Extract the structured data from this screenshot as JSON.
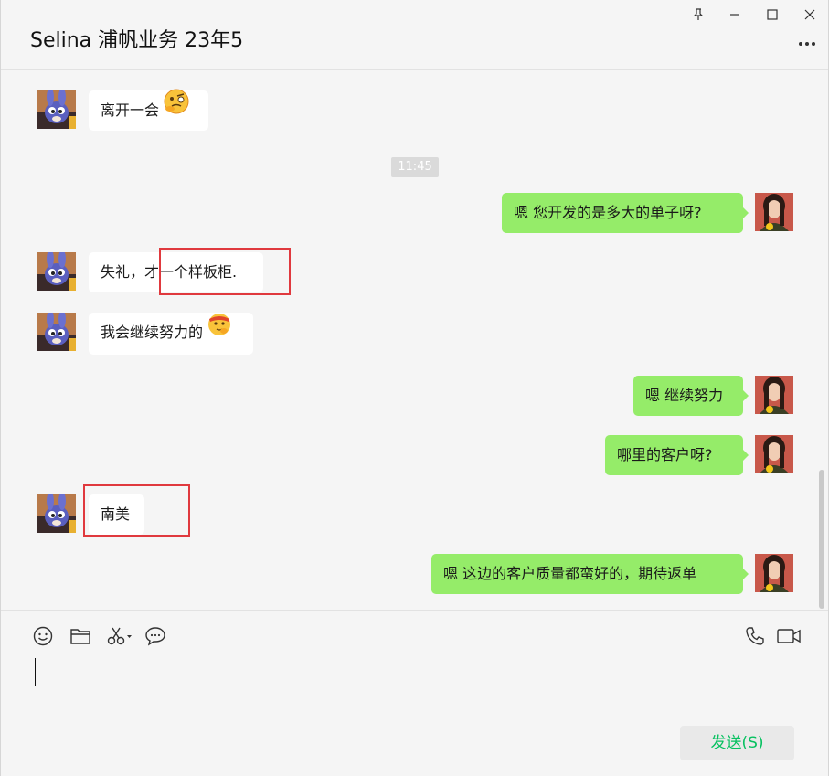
{
  "header": {
    "title": "Selina 浦帆业务 23年5"
  },
  "timestamp": "11:45",
  "messages": [
    {
      "side": "left",
      "text": "离开一会",
      "emoji": "thinking-face-emoji"
    },
    {
      "side": "right",
      "text": "嗯 您开发的是多大的单子呀?"
    },
    {
      "side": "left",
      "text": "失礼，才一个样板柜."
    },
    {
      "side": "left",
      "text": "我会继续努力的",
      "emoji": "shushing-face-emoji"
    },
    {
      "side": "right",
      "text": "嗯 继续努力"
    },
    {
      "side": "right",
      "text": "哪里的客户呀?"
    },
    {
      "side": "left",
      "text": "南美"
    },
    {
      "side": "right",
      "text": "嗯 这边的客户质量都蛮好的，期待返单"
    }
  ],
  "input": {
    "send_label": "发送(S)"
  },
  "colors": {
    "self_bubble": "#95ec69",
    "other_bubble": "#ffffff",
    "send_text": "#07c160",
    "highlight": "#e0393e"
  }
}
